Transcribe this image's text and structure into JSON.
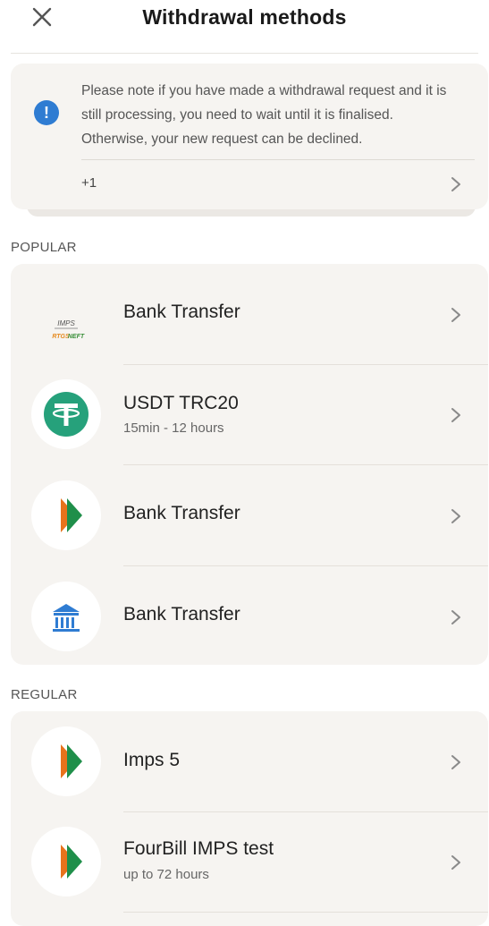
{
  "header": {
    "title": "Withdrawal methods",
    "close_icon": "close-icon"
  },
  "notice": {
    "icon": "info-icon",
    "icon_glyph": "!",
    "text_lines": [
      "Please note if you have made a withdrawal request and it is",
      "still processing, you need to wait until it is finalised.",
      "Otherwise, your new request can be declined."
    ],
    "more": "+1",
    "accent_color": "#2f7cd2"
  },
  "popular": {
    "label": "POPULAR",
    "items": [
      {
        "title": "Bank Transfer",
        "subtitle": "",
        "icon": "imps-rtgs-neft-logo",
        "logo_text_1": "IMPS",
        "logo_text_2": "RTGS",
        "logo_text_3": "NEFT"
      },
      {
        "title": "USDT TRC20",
        "subtitle": "15min - 12 hours",
        "icon": "tether-icon",
        "color": "#26a17b"
      },
      {
        "title": "Bank Transfer",
        "subtitle": "",
        "icon": "upi-icon"
      },
      {
        "title": "Bank Transfer",
        "subtitle": "",
        "icon": "bank-icon",
        "color": "#2f7cd2"
      }
    ]
  },
  "regular": {
    "label": "REGULAR",
    "items": [
      {
        "title": "Imps 5",
        "subtitle": "",
        "icon": "upi-icon"
      },
      {
        "title": "FourBill IMPS test",
        "subtitle": "up to 72 hours",
        "icon": "upi-icon"
      }
    ]
  }
}
